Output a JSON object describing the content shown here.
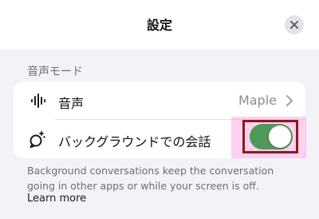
{
  "header": {
    "title": "設定",
    "close_icon": "close-icon"
  },
  "voice_mode_section": {
    "title": "音声モード",
    "rows": [
      {
        "icon": "waveform-icon",
        "label": "音声",
        "value": "Maple",
        "chevron_icon": "chevron-right-icon"
      },
      {
        "icon": "background-chat-icon",
        "label": "バックグラウンドでの会話",
        "toggle_on": true
      }
    ]
  },
  "footnote": {
    "text": "Background conversations keep the conversation going in other apps or while your screen is off.",
    "link_label": "Learn more"
  },
  "colors": {
    "toggle_on": "#4e9a5b",
    "highlight": "#ff96dc",
    "highlight_border": "#8b1a1a"
  }
}
